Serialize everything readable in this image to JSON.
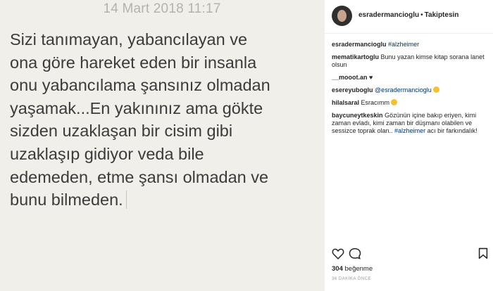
{
  "note": {
    "date": "14 Mart 2018 11:17",
    "lines": [
      "Sizi tanımayan, yabancılayan ve",
      "ona göre hareket eden bir insanla",
      "onu yabancılama şansınız olmadan",
      "yaşamak...En yakınınız ama gökte",
      "sizden uzaklaşan bir cisim gibi",
      "uzaklaşıp gidiyor veda bile",
      "edemeden, etme şansı olmadan ve",
      "bunu bilmeden."
    ]
  },
  "header": {
    "username": "esradermancioglu",
    "separator": "•",
    "follow_status": "Takiptesin"
  },
  "comments": [
    {
      "user": "esradermancioglu",
      "text": "#alzheimer"
    },
    {
      "user": "mematikartoglu",
      "text": "Bunu yazan kimse kitap sorana lanet olsun"
    },
    {
      "user": "__mooot.an",
      "text": "♥"
    },
    {
      "user": "esereyuboglu",
      "text": "@esradermancioglu"
    },
    {
      "user": "hilalsaral",
      "text": "Esracımm"
    },
    {
      "user": "baycuneytkeskin",
      "text": "Gözünün içine bakıp eriyen, kimi zaman evladı, kimi zaman bir düşmanı olabilen ve sessizce toprak olan.. ",
      "tag": "#alzheimer",
      "text2": " acı bir farkındalık!"
    }
  ],
  "footer": {
    "likes_count": "304",
    "likes_label": "beğenme",
    "timestamp": "36 DAKİKA ÖNCE"
  },
  "icons": {
    "like": "heart-icon",
    "comment": "comment-icon",
    "save": "bookmark-icon"
  },
  "colors": {
    "note_background": "#f1efe9",
    "note_text": "#3b3b3b",
    "link": "#003569"
  }
}
